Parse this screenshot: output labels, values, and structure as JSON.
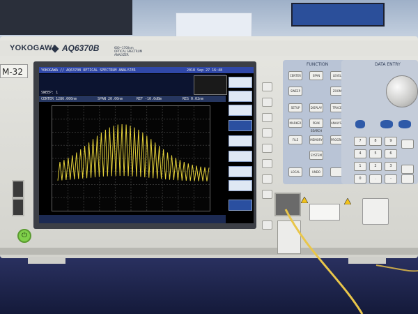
{
  "instrument": {
    "brand": "YOKOGAWA",
    "model": "AQ6370B",
    "model_sub_1": "600~1700nm",
    "model_sub_2": "OPTICAL SPECTRUM ANALYZER",
    "asset_tag": "M-32"
  },
  "screen": {
    "title": "YOKOGAWA // AQ6370B OPTICAL SPECTRUM ANALYZER",
    "datetime": "2018 Sep 27 16:48",
    "sweep_info": "SWEEP: 1",
    "center_readout": "CENTER 1286.000nm",
    "span_readout": "SPAN 20.00nm",
    "ref_readout": "REF -10.0dBm",
    "res_readout": "RES 0.02nm",
    "softkeys": [
      "",
      "",
      "",
      "",
      "",
      "",
      "",
      "",
      "",
      "",
      "",
      "",
      "",
      "",
      ""
    ],
    "trace_color": "#e6d23a"
  },
  "panel": {
    "function_label": "FUNCTION",
    "data_entry_label": "DATA ENTRY",
    "function_keys": [
      "CENTER",
      "SPAN",
      "LEVEL",
      "SWEEP",
      "ZOOM",
      "SETUP",
      "DISPLAY",
      "TRACE",
      "MARKER",
      "PEAK SEARCH",
      "ANALYSIS",
      "FILE",
      "MEMORY",
      "PROGRAM",
      "SYSTEM",
      "LOCAL",
      "UNDO",
      "",
      "",
      ""
    ],
    "numpad": [
      "7",
      "8",
      "9",
      "4",
      "5",
      "6",
      "1",
      "2",
      "3",
      "0",
      ".",
      "-"
    ],
    "accent_blue": "#2f5aa8"
  }
}
